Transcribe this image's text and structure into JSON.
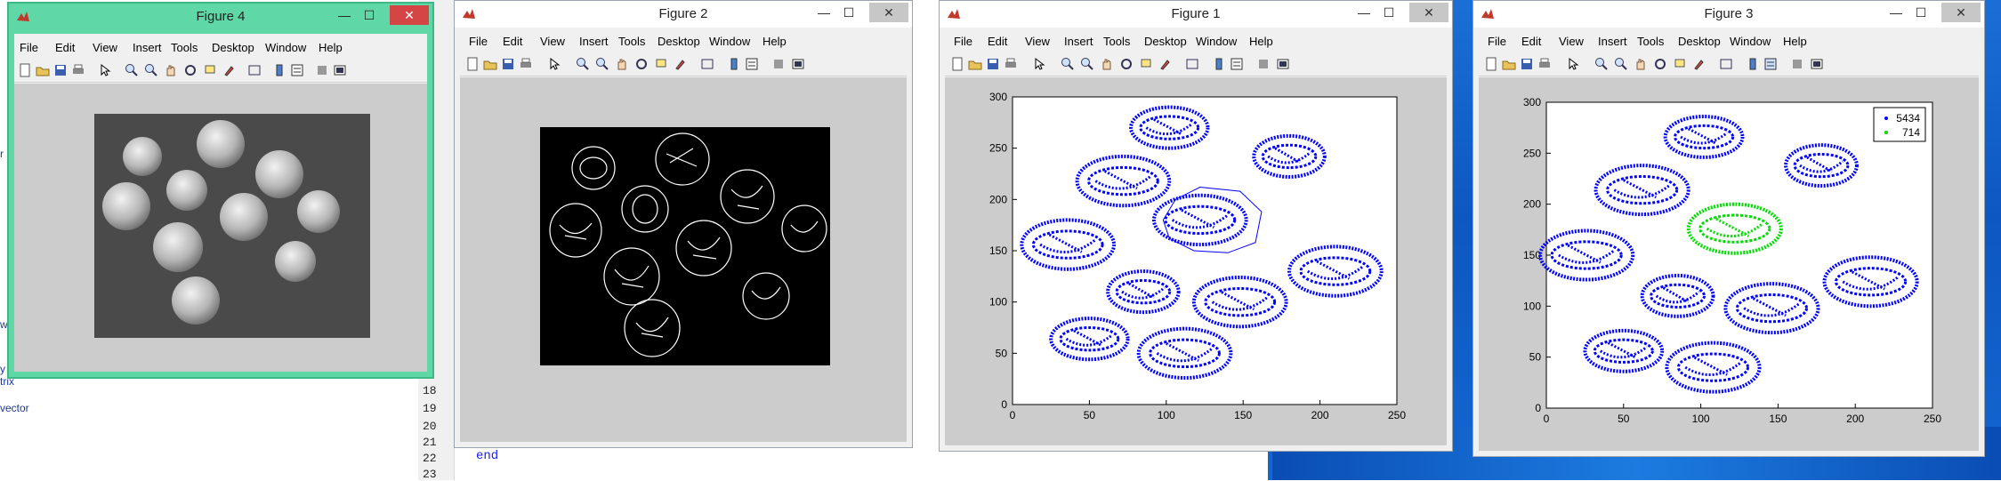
{
  "menu": [
    "File",
    "Edit",
    "View",
    "Insert",
    "Tools",
    "Desktop",
    "Window",
    "Help"
  ],
  "editor": {
    "line_numbers": [
      "18",
      "19",
      "20",
      "21",
      "22",
      "23"
    ],
    "end_keyword": "end"
  },
  "left_panel": {
    "line_a": "we",
    "line_b": "y",
    "line_c": "trix",
    "line_d": "vector",
    "line_e": "r"
  },
  "figures": {
    "fig4": {
      "title": "Figure 4"
    },
    "fig2": {
      "title": "Figure 2"
    },
    "fig1": {
      "title": "Figure 1"
    },
    "fig3": {
      "title": "Figure 3"
    }
  },
  "window_buttons": {
    "minimize": "—",
    "maximize": "☐",
    "close": "✕"
  },
  "colors": {
    "blue_points": "#0000ff",
    "green_points": "#00ff00",
    "active_frame": "#60d7a6"
  },
  "chart_data": [
    {
      "figure": "Figure 1",
      "type": "scatter",
      "xlim": [
        0,
        250
      ],
      "ylim": [
        0,
        300
      ],
      "xticks": [
        "0",
        "50",
        "100",
        "150",
        "200",
        "250"
      ],
      "yticks": [
        "0",
        "50",
        "100",
        "150",
        "200",
        "250",
        "300"
      ],
      "grid": false,
      "series": [
        {
          "color": "#0000ff",
          "shape": "ellipses",
          "ellipses": [
            [
              102,
              270,
              25,
              20
            ],
            [
              180,
              242,
              23,
              20
            ],
            [
              72,
              218,
              30,
              24
            ],
            [
              122,
              180,
              30,
              24
            ],
            [
              36,
              156,
              30,
              24
            ],
            [
              85,
              110,
              23,
              20
            ],
            [
              148,
              100,
              30,
              24
            ],
            [
              210,
              130,
              30,
              24
            ],
            [
              50,
              64,
              25,
              20
            ],
            [
              112,
              50,
              30,
              24
            ]
          ]
        },
        {
          "color": "#0000ff",
          "shape": "polygon",
          "points": [
            [
              122,
              212
            ],
            [
              148,
              208
            ],
            [
              162,
              188
            ],
            [
              158,
              158
            ],
            [
              140,
              148
            ],
            [
              118,
              150
            ],
            [
              102,
              162
            ],
            [
              98,
              180
            ],
            [
              106,
              200
            ]
          ]
        }
      ]
    },
    {
      "figure": "Figure 3",
      "type": "scatter",
      "xlim": [
        0,
        250
      ],
      "ylim": [
        0,
        300
      ],
      "xticks": [
        "0",
        "50",
        "100",
        "150",
        "200",
        "250"
      ],
      "yticks": [
        "0",
        "50",
        "100",
        "150",
        "200",
        "250",
        "300"
      ],
      "grid": false,
      "legend": {
        "position": "top-right",
        "entries": [
          "5434",
          "714"
        ]
      },
      "series": [
        {
          "name": "5434",
          "color": "#0000ff",
          "ellipses": [
            [
              102,
              266,
              25,
              20
            ],
            [
              178,
              238,
              23,
              20
            ],
            [
              62,
              214,
              30,
              24
            ],
            [
              26,
              150,
              30,
              24
            ],
            [
              85,
              110,
              23,
              20
            ],
            [
              146,
              98,
              30,
              24
            ],
            [
              210,
              124,
              30,
              24
            ],
            [
              50,
              56,
              25,
              20
            ],
            [
              108,
              40,
              30,
              24
            ]
          ]
        },
        {
          "name": "714",
          "color": "#00dd00",
          "ellipses": [
            [
              122,
              176,
              30,
              24
            ]
          ]
        }
      ]
    }
  ]
}
